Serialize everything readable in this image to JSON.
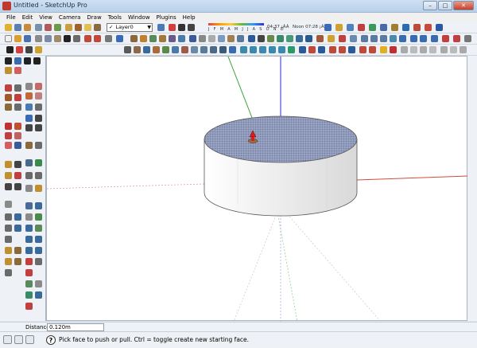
{
  "window": {
    "title": "Untitled - SketchUp Pro"
  },
  "menu": {
    "items": [
      "File",
      "Edit",
      "View",
      "Camera",
      "Draw",
      "Tools",
      "Window",
      "Plugins",
      "Help"
    ]
  },
  "layers": {
    "current": "Layer0"
  },
  "shadows": {
    "months": "J F M A M J J A S O N D",
    "time_start": "04:37 ¡ÀÀ",
    "time_end": "Noon 07:28 ¡ÀÈÄ"
  },
  "vcb": {
    "label": "Distance",
    "value": "0.120m"
  },
  "status": {
    "help_glyph": "?",
    "message": "Pick face to push or pull.  Ctrl = toggle create new starting face."
  },
  "colors": {
    "axis_red": "#d44a3a",
    "axis_green": "#3aa33a",
    "axis_blue": "#2a2ad8",
    "face_top": "#8f9ab8",
    "face_side": "#f2f2f2"
  }
}
